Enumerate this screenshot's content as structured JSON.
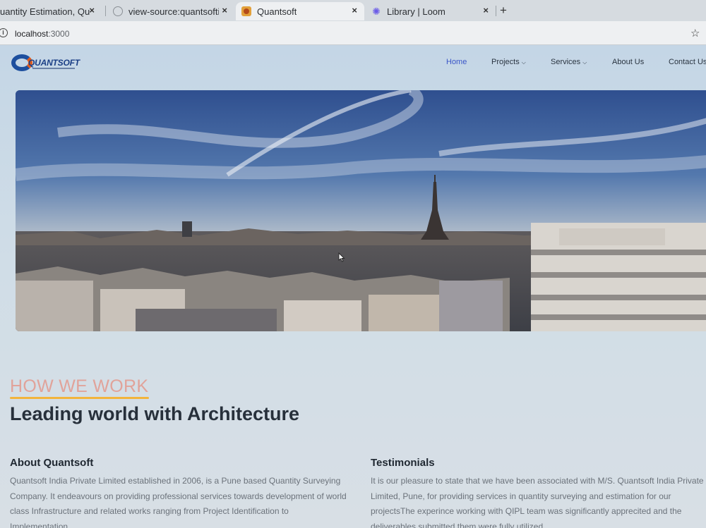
{
  "browser": {
    "tabs": [
      {
        "title": "uantity Estimation, Qu",
        "active": false
      },
      {
        "title": "view-source:quantsoftin",
        "active": false
      },
      {
        "title": "Quantsoft",
        "active": true
      },
      {
        "title": "Library | Loom",
        "active": false
      }
    ],
    "new_tab": "+",
    "close_glyph": "×",
    "url_host": "localhost",
    "url_port": ":3000"
  },
  "site": {
    "logo_text": "QUANTSOFT",
    "nav": [
      {
        "label": "Home",
        "active": true,
        "dropdown": false
      },
      {
        "label": "Projects",
        "active": false,
        "dropdown": true
      },
      {
        "label": "Services",
        "active": false,
        "dropdown": true
      },
      {
        "label": "About Us",
        "active": false,
        "dropdown": false
      },
      {
        "label": "Contact Us",
        "active": false,
        "dropdown": false
      }
    ]
  },
  "section": {
    "eyebrow": "HOW WE WORK",
    "heading": "Leading world with Architecture"
  },
  "about": {
    "title": "About Quantsoft",
    "text": "Quantsoft India Private Limited established in 2006, is a Pune based Quantity Surveying Company. It endeavours on providing professional services towards development of world class Infrastructure and related works ranging from Project Identification to Implementation."
  },
  "testimonials": {
    "title": "Testimonials",
    "text": "It is our pleasure to state that we have been associated with M/S. Quantsoft India Private Limited, Pune, for providing services in quantity surveying and estimation for our projectsThe experince working with QIPL team was significantly apprecited and the deliverables submitted them were fully utilized."
  },
  "icons": {
    "info": "info-icon",
    "star": "bookmark-star-icon",
    "chevron": "chevron-down-icon"
  }
}
